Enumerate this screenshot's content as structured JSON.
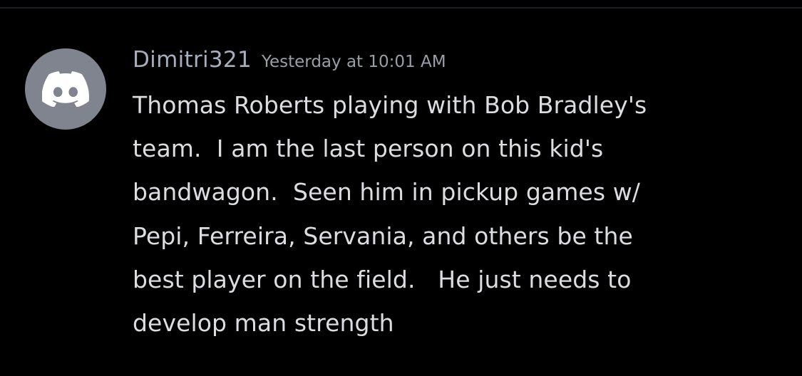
{
  "message": {
    "author": "Dimitri321",
    "timestamp": "Yesterday at 10:01 AM",
    "avatar_icon": "discord-logo-icon",
    "lines": [
      "Thomas Roberts playing with Bob Bradley's",
      "team.  I am the last person on this kid's",
      "bandwagon.  Seen him in pickup games w/",
      "Pepi, Ferreira, Servania, and others be the",
      "best player on the field.   He just needs to",
      "develop man strength"
    ]
  },
  "colors": {
    "background": "#000000",
    "avatar_bg": "#80848e",
    "username": "#a6adbd",
    "timestamp": "#9a9ea6",
    "text": "#dcdde1"
  }
}
